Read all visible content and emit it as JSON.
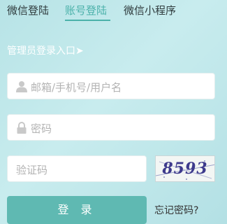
{
  "tabs": [
    {
      "label": "微信登陆"
    },
    {
      "label": "账号登陆"
    },
    {
      "label": "微信小程序"
    }
  ],
  "admin_link": "管理员登录入口➤",
  "form": {
    "username_placeholder": "邮箱/手机号/用户名",
    "password_placeholder": "密码",
    "captcha_placeholder": "验证码",
    "captcha_text": "8593"
  },
  "actions": {
    "login_label": "登 录",
    "forgot_label": "忘记密码?"
  },
  "icons": {
    "username": "user-icon",
    "password": "lock-icon"
  },
  "colors": {
    "accent": "#4bb1aa",
    "button": "#5fb9b2"
  }
}
